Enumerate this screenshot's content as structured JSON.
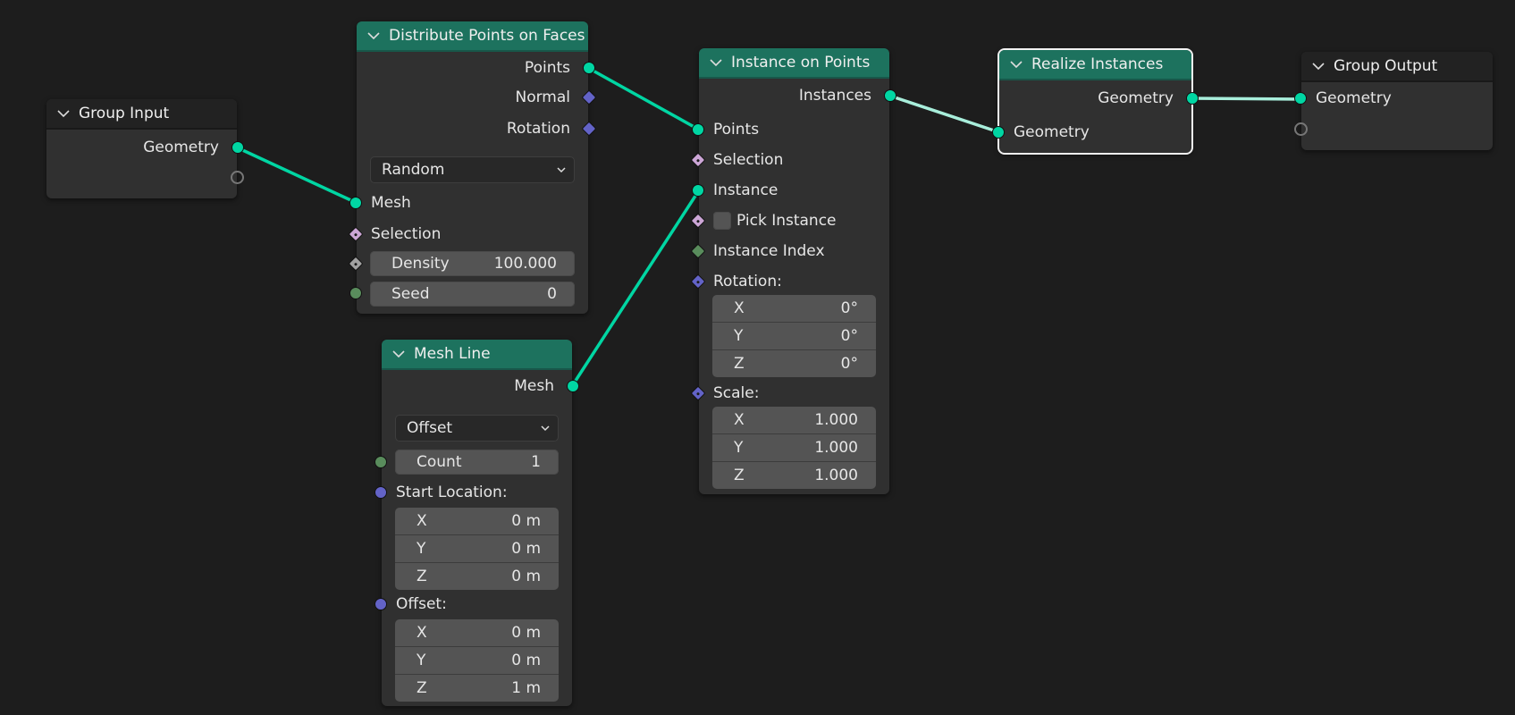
{
  "editor": "Geometry Node Editor",
  "colors": {
    "canvas_bg": "#1d1d1d",
    "node_bg": "#303030",
    "geometry_header": "#1d725e",
    "group_header": "#222222",
    "link": "#00d6a3",
    "link_highlight": "#a8eedb",
    "socket_geometry": "#00d6a3",
    "socket_integer": "#598c5c",
    "socket_vector": "#6363c7",
    "socket_boolean": "#cca6d6",
    "socket_float": "#a1a1a1"
  },
  "nodes": {
    "group_input": {
      "title": "Group Input",
      "outputs": [
        "Geometry"
      ]
    },
    "distribute": {
      "title": "Distribute Points on Faces",
      "outputs": [
        "Points",
        "Normal",
        "Rotation"
      ],
      "mode": "Random",
      "inputs": {
        "mesh": "Mesh",
        "selection": "Selection",
        "density_label": "Density",
        "density_value": "100.000",
        "seed_label": "Seed",
        "seed_value": "0"
      }
    },
    "mesh_line": {
      "title": "Mesh Line",
      "output": "Mesh",
      "mode": "Offset",
      "count_label": "Count",
      "count_value": "1",
      "start_location_label": "Start Location:",
      "start_location": [
        {
          "axis": "X",
          "value": "0 m"
        },
        {
          "axis": "Y",
          "value": "0 m"
        },
        {
          "axis": "Z",
          "value": "0 m"
        }
      ],
      "offset_label": "Offset:",
      "offset": [
        {
          "axis": "X",
          "value": "0 m"
        },
        {
          "axis": "Y",
          "value": "0 m"
        },
        {
          "axis": "Z",
          "value": "1 m"
        }
      ]
    },
    "instance_on_points": {
      "title": "Instance on Points",
      "output": "Instances",
      "inputs": {
        "points": "Points",
        "selection": "Selection",
        "instance": "Instance",
        "pick_instance": "Pick Instance",
        "instance_index": "Instance Index",
        "rotation_label": "Rotation:",
        "scale_label": "Scale:"
      },
      "pick_instance_checked": false,
      "rotation": [
        {
          "axis": "X",
          "value": "0°"
        },
        {
          "axis": "Y",
          "value": "0°"
        },
        {
          "axis": "Z",
          "value": "0°"
        }
      ],
      "scale": [
        {
          "axis": "X",
          "value": "1.000"
        },
        {
          "axis": "Y",
          "value": "1.000"
        },
        {
          "axis": "Z",
          "value": "1.000"
        }
      ]
    },
    "realize_instances": {
      "title": "Realize Instances",
      "output": "Geometry",
      "input": "Geometry",
      "selected": true
    },
    "group_output": {
      "title": "Group Output",
      "inputs": [
        "Geometry"
      ]
    }
  },
  "links": [
    {
      "from": "Group Input.Geometry",
      "to": "Distribute Points on Faces.Mesh",
      "highlight": false
    },
    {
      "from": "Distribute Points on Faces.Points",
      "to": "Instance on Points.Points",
      "highlight": false
    },
    {
      "from": "Mesh Line.Mesh",
      "to": "Instance on Points.Instance",
      "highlight": false
    },
    {
      "from": "Instance on Points.Instances",
      "to": "Realize Instances.Geometry",
      "highlight": true
    },
    {
      "from": "Realize Instances.Geometry",
      "to": "Group Output.Geometry",
      "highlight": true
    }
  ]
}
